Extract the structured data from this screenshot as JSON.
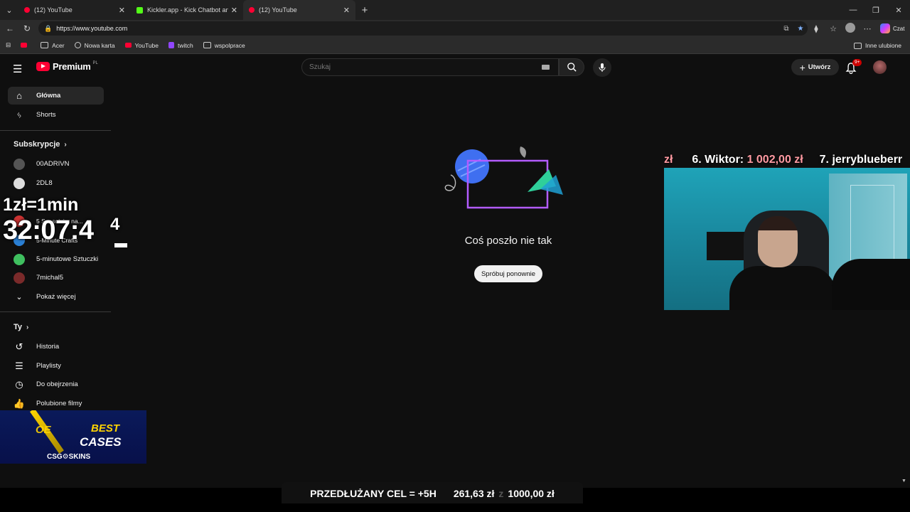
{
  "browser": {
    "tabs": [
      {
        "title": "(12) YouTube",
        "favicon": "youtube-icon",
        "active": false
      },
      {
        "title": "Kickler.app - Kick Chatbot and Ov",
        "favicon": "kickler-icon",
        "active": false
      },
      {
        "title": "(12) YouTube",
        "favicon": "youtube-icon",
        "active": true
      }
    ],
    "url": "https://www.youtube.com",
    "copilot_label": "Czat",
    "bookmarks": [
      {
        "label": "",
        "icon": "youtube-icon"
      },
      {
        "label": "Acer",
        "icon": "folder-icon"
      },
      {
        "label": "Nowa karta",
        "icon": "globe-icon"
      },
      {
        "label": "YouTube",
        "icon": "youtube-icon"
      },
      {
        "label": "twitch",
        "icon": "twitch-icon"
      },
      {
        "label": "wspolprace",
        "icon": "folder-icon"
      }
    ],
    "other_favorites": "Inne ulubione"
  },
  "youtube": {
    "logo_text": "Premium",
    "region": "PL",
    "search_placeholder": "Szukaj",
    "create_label": "Utwórz",
    "notification_badge": "9+",
    "sidebar": {
      "main": [
        {
          "label": "Główna",
          "icon": "home-icon",
          "active": true
        },
        {
          "label": "Shorts",
          "icon": "shorts-icon",
          "active": false
        }
      ],
      "subscriptions_title": "Subskrypcje",
      "subscriptions": [
        {
          "label": "00ADRIVN",
          "color": "#555555"
        },
        {
          "label": "2DL8",
          "color": "#dddddd"
        },
        {
          "label": "5 Sposobów na...",
          "color": "#cc3333"
        },
        {
          "label": "5-Minute Crafts",
          "color": "#2a7fd4"
        },
        {
          "label": "5-minutowe Sztuczki",
          "color": "#3fbf5f"
        },
        {
          "label": "7michal5",
          "color": "#7a2a2a"
        }
      ],
      "show_more": "Pokaż więcej",
      "you_title": "Ty",
      "you_items": [
        {
          "label": "Historia",
          "icon": "history-icon"
        },
        {
          "label": "Playlisty",
          "icon": "playlist-icon"
        },
        {
          "label": "Do obejrzenia",
          "icon": "clock-icon"
        },
        {
          "label": "Polubione filmy",
          "icon": "thumbs-up-icon"
        }
      ]
    },
    "error": {
      "message": "Coś poszło nie tak",
      "retry_label": "Spróbuj ponownie"
    }
  },
  "stream_overlays": {
    "rate": "1zł=1min",
    "countdown": "32:07:4",
    "countdown_extra": "4",
    "donors": [
      {
        "prefix": "",
        "name": "",
        "amount": "zł"
      },
      {
        "prefix": "6. ",
        "name": "Wiktor: ",
        "amount": "1 002,00 zł"
      },
      {
        "prefix": "7. ",
        "name": "jerryblueberr",
        "amount": ""
      }
    ],
    "banner": {
      "pre": "OE",
      "best": "BEST",
      "cases": "CASES",
      "brand": "CSG⚙SKINS"
    },
    "goal": {
      "label": "PRZEDŁUŻANY CEL = +5H",
      "current": "261,63 zł",
      "sep": "z",
      "target": "1000,00 zł"
    }
  }
}
